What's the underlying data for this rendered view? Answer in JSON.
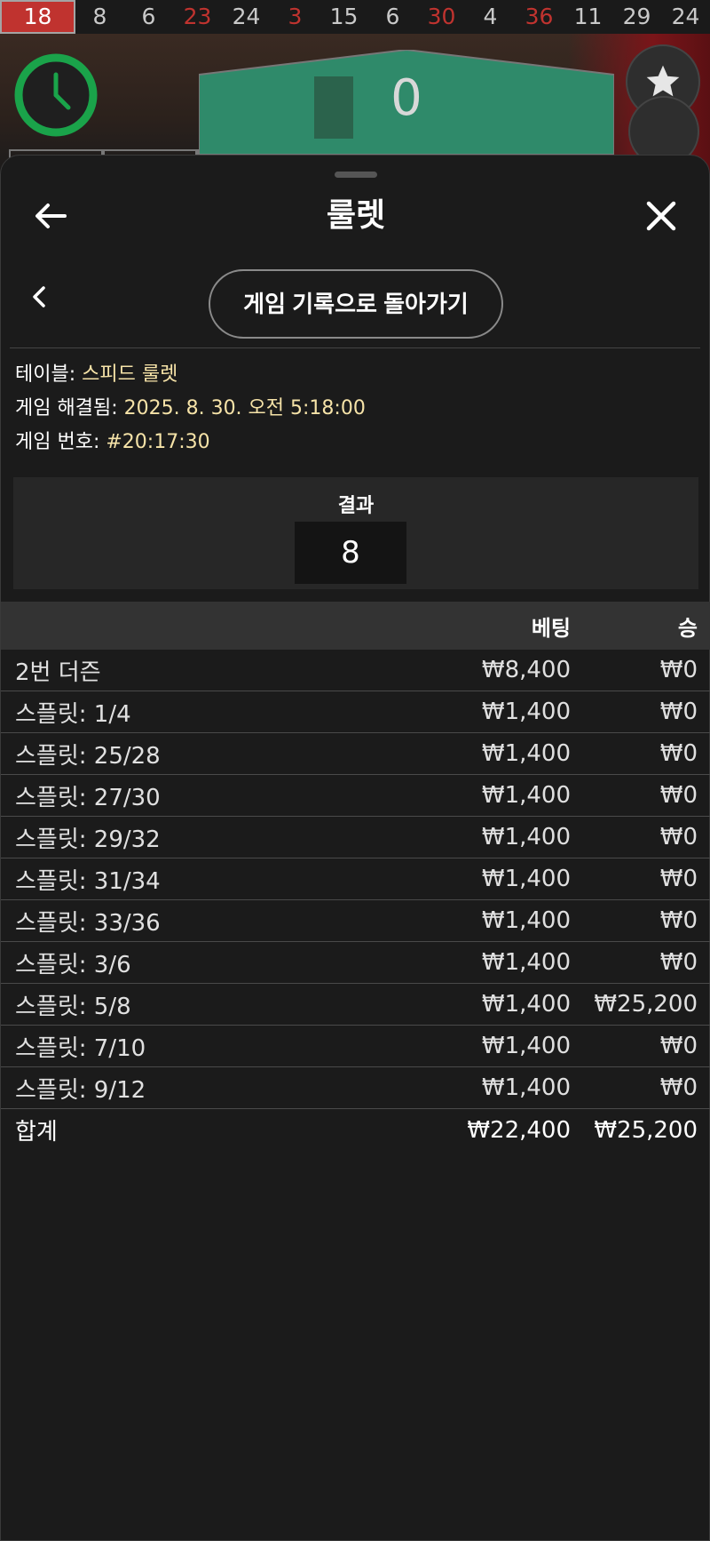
{
  "game_strip": {
    "latest_number": "18",
    "recent_numbers": [
      {
        "value": "8",
        "color": "black"
      },
      {
        "value": "6",
        "color": "black"
      },
      {
        "value": "23",
        "color": "red"
      },
      {
        "value": "24",
        "color": "black"
      },
      {
        "value": "3",
        "color": "red"
      },
      {
        "value": "15",
        "color": "black"
      },
      {
        "value": "6",
        "color": "black"
      },
      {
        "value": "30",
        "color": "red"
      },
      {
        "value": "4",
        "color": "black"
      },
      {
        "value": "36",
        "color": "red"
      },
      {
        "value": "11",
        "color": "black"
      },
      {
        "value": "29",
        "color": "black"
      },
      {
        "value": "24",
        "color": "black"
      }
    ],
    "zero_cell_label": "0"
  },
  "colors": {
    "red_number": "#c0332f",
    "accent_value": "#f6e3a8",
    "timer_green": "#1aa34a",
    "zero_green": "#2f8a6a"
  },
  "sheet": {
    "title": "룰렛",
    "history_link_label": "게임 기록으로 돌아가기"
  },
  "info": {
    "table_label": "테이블: ",
    "table_value": "스피드 룰렛",
    "resolved_label": "게임 해결됨: ",
    "resolved_value": "2025. 8. 30. 오전 5:18:00",
    "game_no_label": "게임 번호: ",
    "game_no_value": "#20:17:30"
  },
  "result": {
    "label": "결과",
    "value": "8"
  },
  "bets": {
    "header": {
      "name": "",
      "bet": "베팅",
      "win": "승"
    },
    "rows": [
      {
        "name": "2번 더즌",
        "bet": "₩8,400",
        "win": "₩0"
      },
      {
        "name": "스플릿: 1/4",
        "bet": "₩1,400",
        "win": "₩0"
      },
      {
        "name": "스플릿: 25/28",
        "bet": "₩1,400",
        "win": "₩0"
      },
      {
        "name": "스플릿: 27/30",
        "bet": "₩1,400",
        "win": "₩0"
      },
      {
        "name": "스플릿: 29/32",
        "bet": "₩1,400",
        "win": "₩0"
      },
      {
        "name": "스플릿: 31/34",
        "bet": "₩1,400",
        "win": "₩0"
      },
      {
        "name": "스플릿: 33/36",
        "bet": "₩1,400",
        "win": "₩0"
      },
      {
        "name": "스플릿: 3/6",
        "bet": "₩1,400",
        "win": "₩0"
      },
      {
        "name": "스플릿: 5/8",
        "bet": "₩1,400",
        "win": "₩25,200"
      },
      {
        "name": "스플릿: 7/10",
        "bet": "₩1,400",
        "win": "₩0"
      },
      {
        "name": "스플릿: 9/12",
        "bet": "₩1,400",
        "win": "₩0"
      }
    ],
    "total": {
      "name": "합계",
      "bet": "₩22,400",
      "win": "₩25,200"
    }
  },
  "icons": {
    "back": "arrow-left-icon",
    "close": "close-icon",
    "prev": "chevron-left-icon",
    "star": "star-icon",
    "timer": "clock-icon"
  }
}
